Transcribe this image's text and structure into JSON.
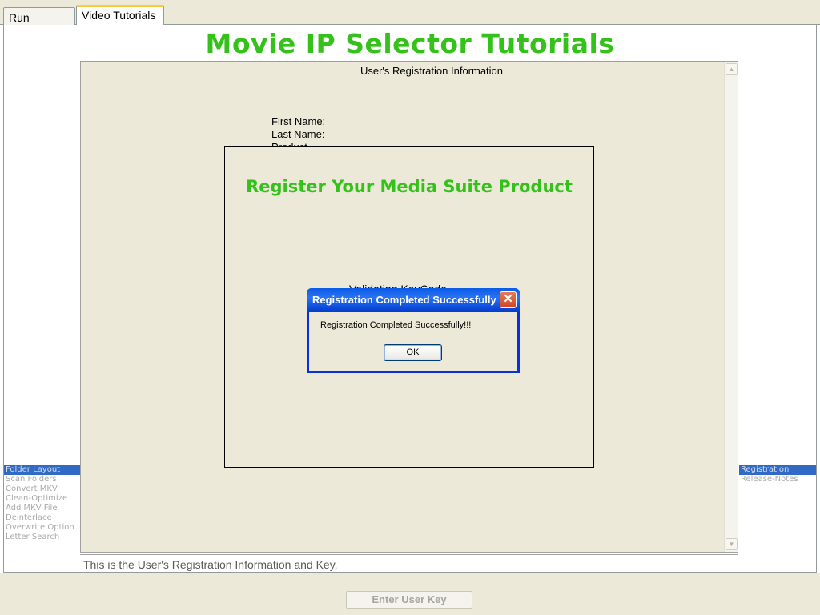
{
  "tabs": [
    {
      "label": "Run Window",
      "active": false
    },
    {
      "label": "Video Tutorials",
      "active": true
    }
  ],
  "main": {
    "title": "Movie IP Selector Tutorials",
    "title_color": "#34c21a"
  },
  "content": {
    "heading": "User's Registration Information",
    "first_name_label": "First Name:",
    "last_name_label": "Last  Name:",
    "product_label": "Product"
  },
  "register_panel": {
    "title": "Register Your Media Suite Product",
    "status_text": "Validating KeyCode"
  },
  "dialog": {
    "title": "Registration Completed Successfully",
    "message": "Registration Completed Successfully!!!",
    "ok_label": "OK"
  },
  "left_list": {
    "selected_index": 0,
    "items": [
      "Folder Layout",
      "Scan Folders",
      "Convert MKV",
      "Clean-Optimize",
      "Add MKV File",
      "Deinterlace",
      "Overwrite Option",
      "Letter Search"
    ]
  },
  "right_list": {
    "selected_index": 0,
    "items": [
      "Registration",
      "Release-Notes"
    ]
  },
  "caption": "This is the User's Registration Information and Key.",
  "bottom": {
    "enter_key_label": "Enter User Key"
  },
  "colors": {
    "accent_green": "#34c21a",
    "selection_blue": "#316ac5",
    "titlebar_blue": "#0a5be8"
  }
}
